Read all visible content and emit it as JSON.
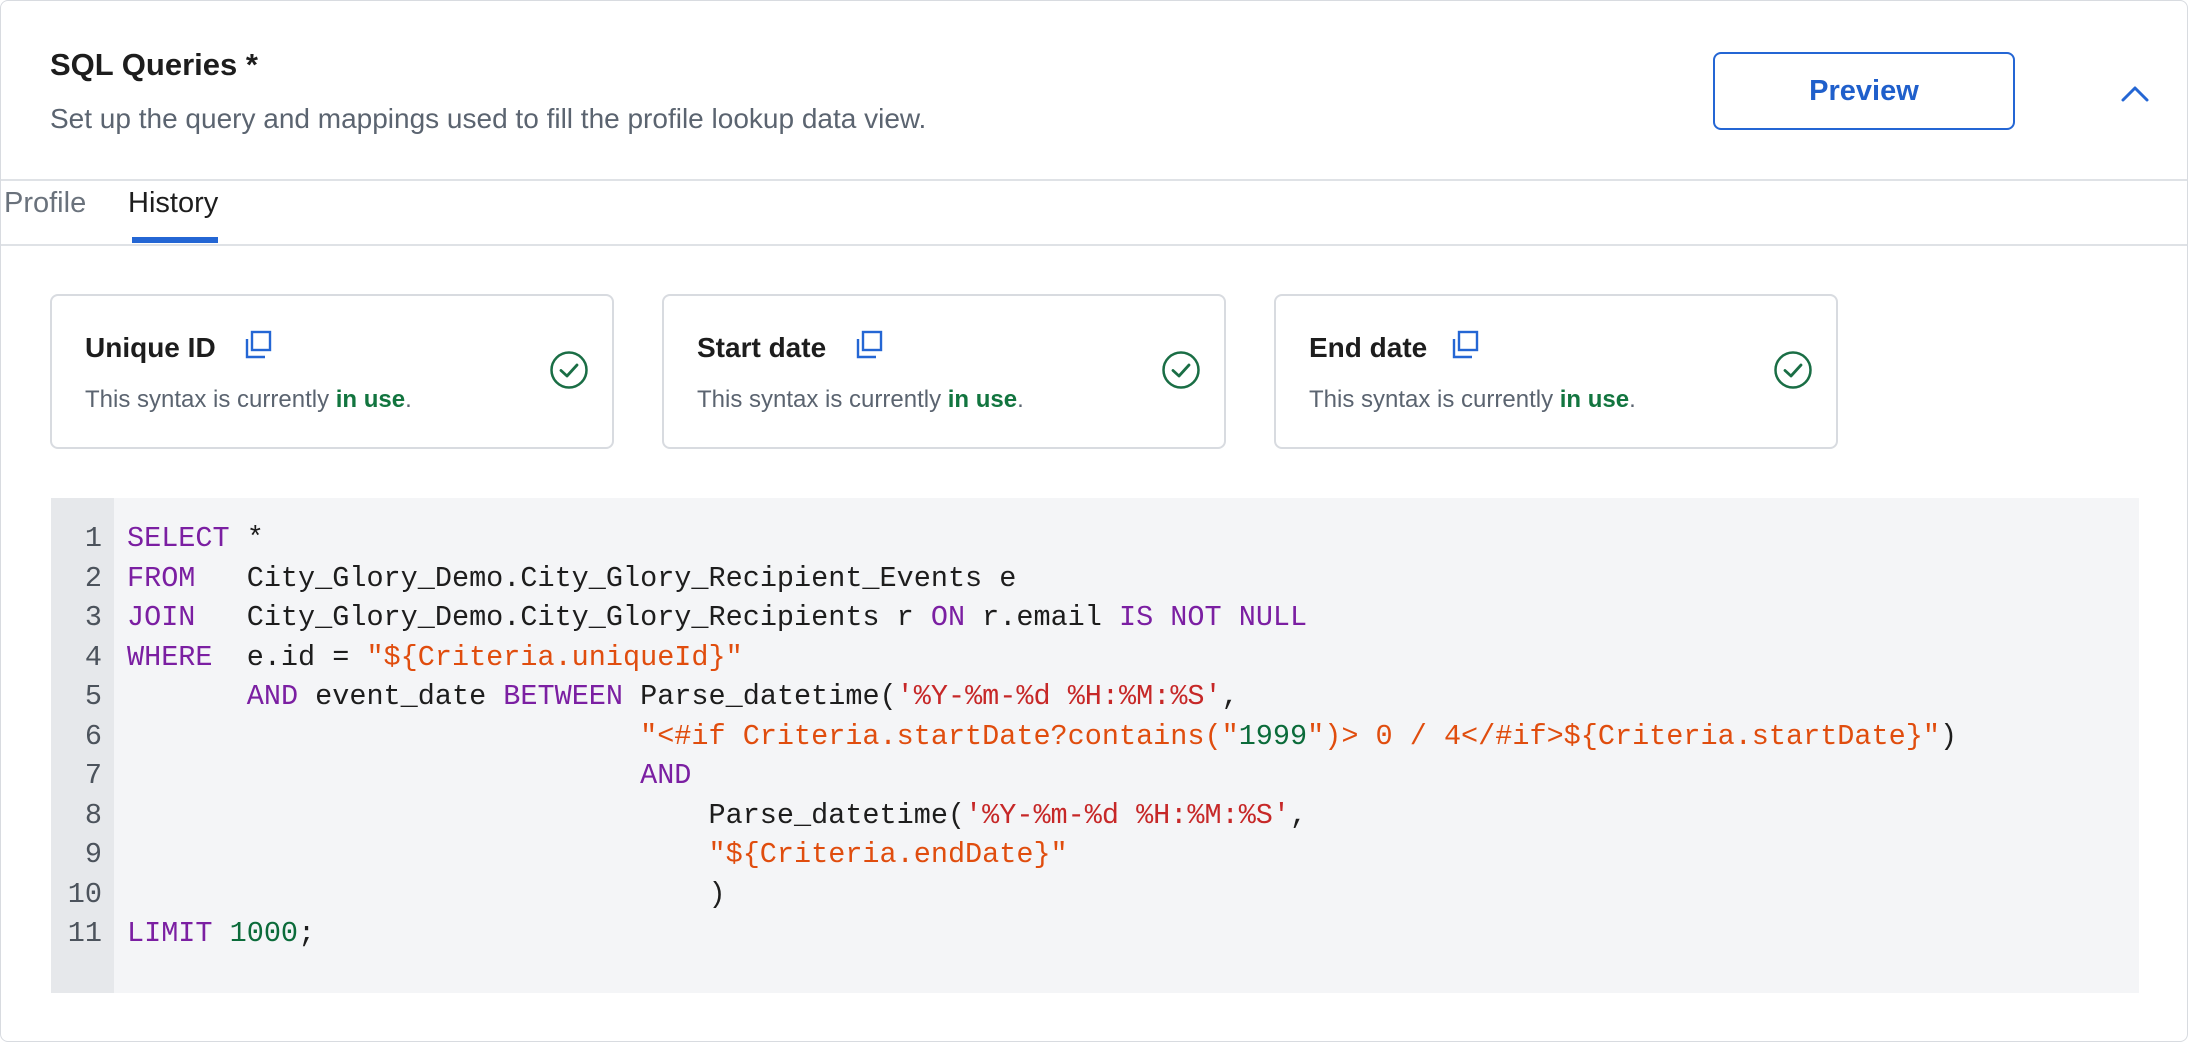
{
  "header": {
    "title": "SQL Queries *",
    "subtitle": "Set up the query and mappings used to fill the profile lookup data view.",
    "preview_label": "Preview"
  },
  "tabs": [
    {
      "label": "Profile",
      "active": false
    },
    {
      "label": "History",
      "active": true
    }
  ],
  "cards": [
    {
      "title": "Unique ID",
      "text_prefix": "This syntax is currently ",
      "text_status": "in use",
      "text_suffix": "."
    },
    {
      "title": "Start date",
      "text_prefix": "This syntax is currently ",
      "text_status": "in use",
      "text_suffix": "."
    },
    {
      "title": "End date",
      "text_prefix": "This syntax is currently ",
      "text_status": "in use",
      "text_suffix": "."
    }
  ],
  "code": {
    "line_numbers": [
      "1",
      "2",
      "3",
      "4",
      "5",
      "6",
      "7",
      "8",
      "9",
      "10",
      "11"
    ],
    "lines": [
      [
        {
          "t": "kw",
          "v": "SELECT"
        },
        {
          "t": "p",
          "v": " *"
        }
      ],
      [
        {
          "t": "kw",
          "v": "FROM"
        },
        {
          "t": "p",
          "v": "   City_Glory_Demo.City_Glory_Recipient_Events e"
        }
      ],
      [
        {
          "t": "kw",
          "v": "JOIN"
        },
        {
          "t": "p",
          "v": "   City_Glory_Demo.City_Glory_Recipients r "
        },
        {
          "t": "kw",
          "v": "ON"
        },
        {
          "t": "p",
          "v": " r.email "
        },
        {
          "t": "kw",
          "v": "IS NOT NULL"
        }
      ],
      [
        {
          "t": "kw",
          "v": "WHERE"
        },
        {
          "t": "p",
          "v": "  e.id = "
        },
        {
          "t": "str",
          "v": "\"${Criteria.uniqueId}\""
        }
      ],
      [
        {
          "t": "p",
          "v": "       "
        },
        {
          "t": "kw",
          "v": "AND"
        },
        {
          "t": "p",
          "v": " event_date "
        },
        {
          "t": "kw",
          "v": "BETWEEN"
        },
        {
          "t": "p",
          "v": " Parse_datetime("
        },
        {
          "t": "sq",
          "v": "'%Y-%m-%d %H:%M:%S'"
        },
        {
          "t": "p",
          "v": ","
        }
      ],
      [
        {
          "t": "p",
          "v": "                              "
        },
        {
          "t": "str",
          "v": "\"<#if Criteria.startDate?contains(\""
        },
        {
          "t": "num",
          "v": "1999"
        },
        {
          "t": "str",
          "v": "\")> 0 / 4</#if>${Criteria.startDate}\""
        },
        {
          "t": "p",
          "v": ")"
        }
      ],
      [
        {
          "t": "p",
          "v": "                              "
        },
        {
          "t": "kw",
          "v": "AND"
        }
      ],
      [
        {
          "t": "p",
          "v": "                                  Parse_datetime("
        },
        {
          "t": "sq",
          "v": "'%Y-%m-%d %H:%M:%S'"
        },
        {
          "t": "p",
          "v": ","
        }
      ],
      [
        {
          "t": "p",
          "v": "                                  "
        },
        {
          "t": "str",
          "v": "\"${Criteria.endDate}\""
        }
      ],
      [
        {
          "t": "p",
          "v": "                                  )"
        }
      ],
      [
        {
          "t": "kw",
          "v": "LIMIT"
        },
        {
          "t": "p",
          "v": " "
        },
        {
          "t": "num",
          "v": "1000"
        },
        {
          "t": "p",
          "v": ";"
        }
      ]
    ]
  },
  "colors": {
    "accent": "#2466d4",
    "success": "#12753f",
    "keyword": "#7b1fa2",
    "string": "#e04d0e",
    "number": "#0b6b3a"
  },
  "icons": {
    "collapse": "chevron-up-icon",
    "copy": "copy-icon",
    "status": "check-circle-icon"
  }
}
